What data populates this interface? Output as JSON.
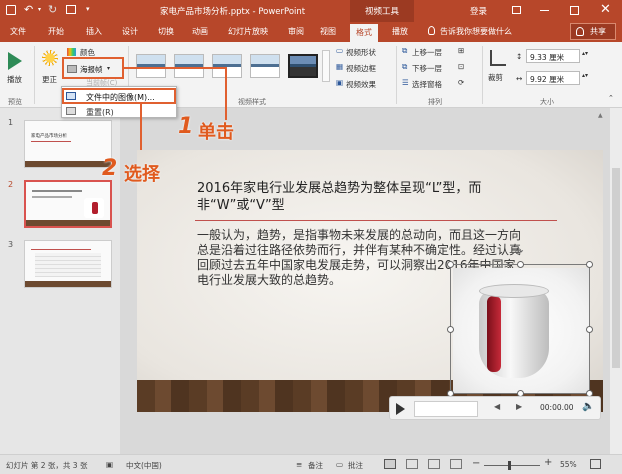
{
  "titlebar": {
    "filename": "家电产品市场分析.pptx - PowerPoint",
    "context_tab": "视频工具",
    "login": "登录",
    "icons": [
      "save-icon",
      "undo-icon",
      "redo-icon",
      "quick-access-more-icon",
      "minimize-icon",
      "restore-icon",
      "close-icon"
    ]
  },
  "tabs": [
    "文件",
    "开始",
    "插入",
    "设计",
    "切换",
    "动画",
    "幻灯片放映",
    "审阅",
    "视图",
    "格式",
    "播放"
  ],
  "active_tab": "格式",
  "tell_me": "告诉我你想要做什么",
  "share": "共享",
  "ribbon": {
    "play_label": "播放",
    "correct_label": "更正",
    "color_label": "颜色",
    "poster_frame_label": "海报帧",
    "reset_label": "重置",
    "group_preview": "预览",
    "group_video_styles": "视频样式",
    "video_shape": "视频形状",
    "video_border": "视频边框",
    "video_effects": "视频效果",
    "bring_forward": "上移一层",
    "send_backward": "下移一层",
    "selection_pane": "选择窗格",
    "group_arrange": "排列",
    "crop_label": "裁剪",
    "height_value": "9.33 厘米",
    "width_value": "9.92 厘米",
    "group_size": "大小"
  },
  "dropdown": {
    "item1": "文件中的图像(M)...",
    "item2": "当前帧(C)",
    "item3": "重置(R)"
  },
  "annotations": {
    "step1_num": "1",
    "step1_text": "单击",
    "step2_num": "2",
    "step2_text": "选择"
  },
  "slides_panel": {
    "numbers": [
      "1",
      "2",
      "3"
    ],
    "slide1_title": "家电产品市场分析"
  },
  "slide": {
    "title": "2016年家电行业发展总趋势为整体呈现“L”型，而非“W”或“V”型",
    "body": "一般认为，趋势，是指事物未来发展的总动向，而且这一方向总是沿着过往路径依势而行，并伴有某种不确定性。经过认真回顾过去五年中国家电发展走势，可以洞察出2016年中国家电行业发展大致的总趋势。"
  },
  "player": {
    "time": "00:00.00"
  },
  "statusbar": {
    "slide_info": "幻灯片 第 2 张，共 3 张",
    "language": "中文(中国)",
    "notes": "备注",
    "comments": "批注",
    "zoom": "55%"
  },
  "colors": {
    "accent": "#b7472a",
    "highlight": "#e05a1e",
    "slide_line": "#c0504d"
  }
}
